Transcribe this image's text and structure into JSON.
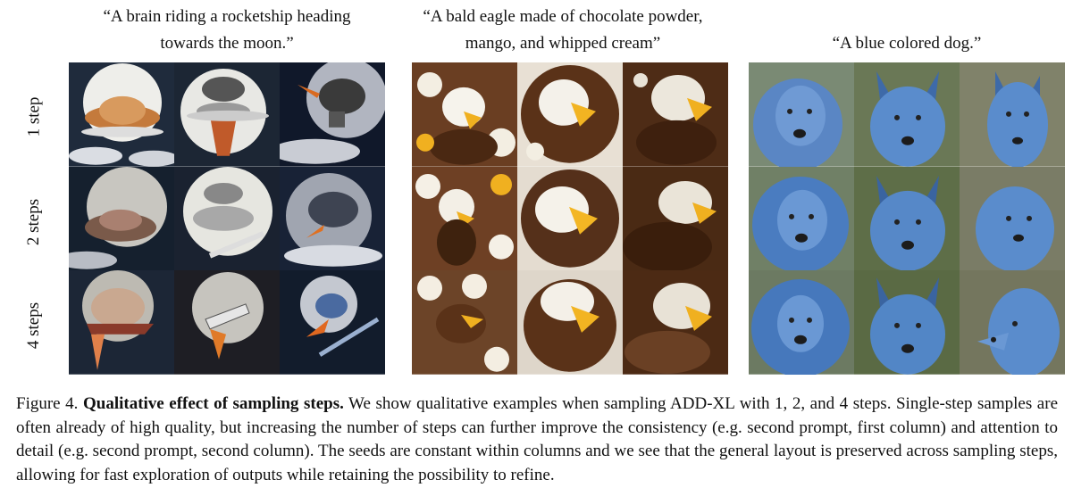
{
  "prompts": [
    {
      "line1": "“A brain riding a rocketship heading",
      "line2": "towards the moon.”"
    },
    {
      "line1": "“A bald eagle made of chocolate powder,",
      "line2": "mango, and whipped cream”"
    },
    {
      "line1": "“A blue colored dog.”",
      "line2": ""
    }
  ],
  "row_labels": [
    "1 step",
    "2 steps",
    "4 steps"
  ],
  "caption": {
    "prefix": "Figure 4. ",
    "title": "Qualitative effect of sampling steps.",
    "body": " We show qualitative examples when sampling ADD-XL with 1, 2, and 4 steps. Single-step samples are often already of high quality, but increasing the number of steps can further improve the consistency (e.g. second prompt, first column) and attention to detail (e.g. second prompt, second column). The seeds are constant within columns and we see that the general layout is preserved across sampling steps, allowing for fast exploration of outputs while retaining the possibility to refine."
  }
}
